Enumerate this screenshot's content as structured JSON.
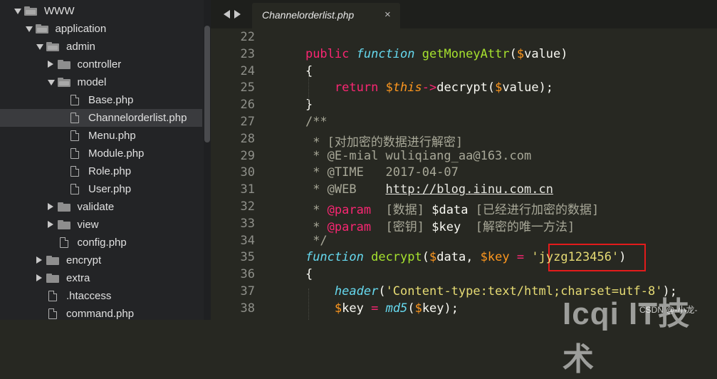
{
  "sidebar": {
    "items": [
      {
        "label": "WWW",
        "type": "folder",
        "open": true,
        "depth": 0,
        "arrow": "down"
      },
      {
        "label": "application",
        "type": "folder",
        "open": true,
        "depth": 1,
        "arrow": "down"
      },
      {
        "label": "admin",
        "type": "folder",
        "open": true,
        "depth": 2,
        "arrow": "down"
      },
      {
        "label": "controller",
        "type": "folder",
        "open": false,
        "depth": 3,
        "arrow": "right"
      },
      {
        "label": "model",
        "type": "folder",
        "open": true,
        "depth": 3,
        "arrow": "down"
      },
      {
        "label": "Base.php",
        "type": "file",
        "depth": 4
      },
      {
        "label": "Channelorderlist.php",
        "type": "file",
        "depth": 4,
        "selected": true
      },
      {
        "label": "Menu.php",
        "type": "file",
        "depth": 4
      },
      {
        "label": "Module.php",
        "type": "file",
        "depth": 4
      },
      {
        "label": "Role.php",
        "type": "file",
        "depth": 4
      },
      {
        "label": "User.php",
        "type": "file",
        "depth": 4
      },
      {
        "label": "validate",
        "type": "folder",
        "open": false,
        "depth": 3,
        "arrow": "right"
      },
      {
        "label": "view",
        "type": "folder",
        "open": false,
        "depth": 3,
        "arrow": "right"
      },
      {
        "label": "config.php",
        "type": "file",
        "depth": 3
      },
      {
        "label": "encrypt",
        "type": "folder",
        "open": false,
        "depth": 2,
        "arrow": "right"
      },
      {
        "label": "extra",
        "type": "folder",
        "open": false,
        "depth": 2,
        "arrow": "right"
      },
      {
        "label": ".htaccess",
        "type": "file",
        "depth": 2
      },
      {
        "label": "command.php",
        "type": "file",
        "depth": 2
      }
    ]
  },
  "tabs": [
    {
      "label": "Channelorderlist.php",
      "close": "×"
    }
  ],
  "editor": {
    "lines": [
      {
        "num": "22",
        "tokens": []
      },
      {
        "num": "23",
        "tokens": [
          [
            "sp",
            "    "
          ],
          [
            "kw",
            "public"
          ],
          [
            "sp",
            " "
          ],
          [
            "sf",
            "function"
          ],
          [
            "sp",
            " "
          ],
          [
            "fn",
            "getMoneyAttr"
          ],
          [
            "vtx",
            "("
          ],
          [
            "var",
            "$"
          ],
          [
            "vtx",
            "value)"
          ]
        ]
      },
      {
        "num": "24",
        "tokens": [
          [
            "sp",
            "    "
          ],
          [
            "vtx",
            "{"
          ]
        ]
      },
      {
        "num": "25",
        "tokens": [
          [
            "sp",
            "        "
          ],
          [
            "kw",
            "return"
          ],
          [
            "sp",
            " "
          ],
          [
            "var",
            "$"
          ],
          [
            "th",
            "this"
          ],
          [
            "op",
            "->"
          ],
          [
            "vtx",
            "decrypt("
          ],
          [
            "var",
            "$"
          ],
          [
            "vtx",
            "value);"
          ]
        ]
      },
      {
        "num": "26",
        "tokens": [
          [
            "sp",
            "    "
          ],
          [
            "vtx",
            "}"
          ]
        ]
      },
      {
        "num": "27",
        "tokens": [
          [
            "sp",
            "    "
          ],
          [
            "cm",
            "/**"
          ]
        ]
      },
      {
        "num": "28",
        "tokens": [
          [
            "sp",
            "     "
          ],
          [
            "cm",
            "* [对加密的数据进行解密]"
          ]
        ]
      },
      {
        "num": "29",
        "tokens": [
          [
            "sp",
            "     "
          ],
          [
            "cm",
            "* @E-mial wuliqiang_aa@163.com"
          ]
        ]
      },
      {
        "num": "30",
        "tokens": [
          [
            "sp",
            "     "
          ],
          [
            "cm",
            "* @TIME   2017-04-07"
          ]
        ]
      },
      {
        "num": "31",
        "tokens": [
          [
            "sp",
            "     "
          ],
          [
            "cm",
            "* @WEB    "
          ],
          [
            "link",
            "http://blog.iinu.com.cn"
          ]
        ]
      },
      {
        "num": "32",
        "tokens": [
          [
            "sp",
            "     "
          ],
          [
            "cm",
            "* "
          ],
          [
            "kw",
            "@param"
          ],
          [
            "cm",
            "  [数据] "
          ],
          [
            "vtx",
            "$data"
          ],
          [
            "cm",
            " [已经进行加密的数据]"
          ]
        ]
      },
      {
        "num": "33",
        "tokens": [
          [
            "sp",
            "     "
          ],
          [
            "cm",
            "* "
          ],
          [
            "kw",
            "@param"
          ],
          [
            "cm",
            "  [密钥] "
          ],
          [
            "vtx",
            "$key"
          ],
          [
            "cm",
            "  [解密的唯一方法]"
          ]
        ]
      },
      {
        "num": "34",
        "tokens": [
          [
            "sp",
            "     "
          ],
          [
            "cm",
            "*/"
          ]
        ]
      },
      {
        "num": "35",
        "tokens": [
          [
            "sp",
            "    "
          ],
          [
            "sf",
            "function"
          ],
          [
            "sp",
            " "
          ],
          [
            "fn",
            "decrypt"
          ],
          [
            "vtx",
            "("
          ],
          [
            "var",
            "$"
          ],
          [
            "vtx",
            "data, "
          ],
          [
            "var",
            "$"
          ],
          [
            "var",
            "key"
          ],
          [
            "sp",
            " "
          ],
          [
            "op",
            "="
          ],
          [
            "sp",
            " "
          ],
          [
            "str",
            "'jyzg123456'"
          ],
          [
            "vtx",
            ")"
          ]
        ]
      },
      {
        "num": "36",
        "tokens": [
          [
            "sp",
            "    "
          ],
          [
            "vtx",
            "{"
          ]
        ]
      },
      {
        "num": "37",
        "tokens": [
          [
            "sp",
            "        "
          ],
          [
            "sf",
            "header"
          ],
          [
            "vtx",
            "("
          ],
          [
            "str",
            "'Content-type:text/html;charset=utf-8'"
          ],
          [
            "vtx",
            ");"
          ]
        ]
      },
      {
        "num": "38",
        "tokens": [
          [
            "sp",
            "        "
          ],
          [
            "var",
            "$"
          ],
          [
            "vtx",
            "key "
          ],
          [
            "op",
            "="
          ],
          [
            "sp",
            " "
          ],
          [
            "sf",
            "md5"
          ],
          [
            "vtx",
            "("
          ],
          [
            "var",
            "$"
          ],
          [
            "vtx",
            "key);"
          ]
        ]
      }
    ]
  },
  "watermark": {
    "text": "Icqi IT技术",
    "credit": "CSDN @-小龙-"
  },
  "colors": {
    "highlight_box": "#e31b1b",
    "background": "#272822",
    "sidebar": "#232426"
  }
}
